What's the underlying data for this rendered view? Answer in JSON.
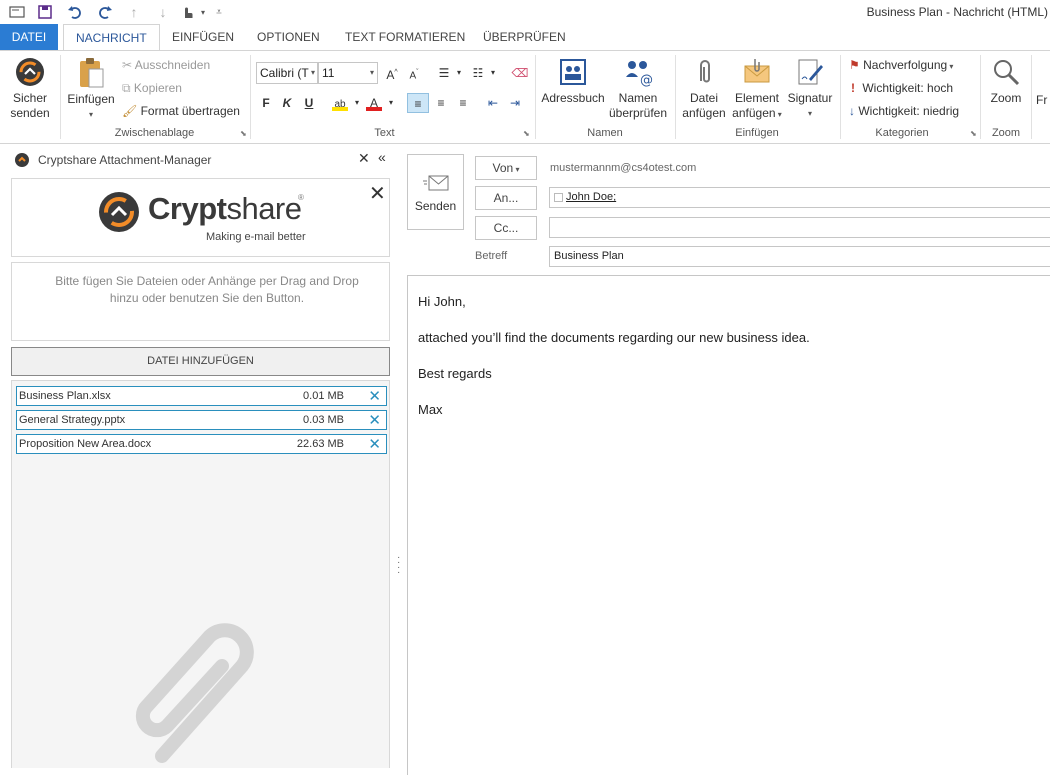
{
  "window": {
    "title": "Business Plan - Nachricht (HTML)"
  },
  "tabs": [
    "DATEI",
    "NACHRICHT",
    "EINFÜGEN",
    "OPTIONEN",
    "TEXT FORMATIEREN",
    "ÜBERPRÜFEN"
  ],
  "ribbon": {
    "secure_send": {
      "line1": "Sicher",
      "line2": "senden"
    },
    "clipboard": {
      "label": "Zwischenablage",
      "paste": "Einfügen",
      "cut": "Ausschneiden",
      "copy": "Kopieren",
      "format_painter": "Format übertragen"
    },
    "text": {
      "label": "Text",
      "font": "Calibri (T",
      "size": "11",
      "bold": "F",
      "italic": "K",
      "underline": "U"
    },
    "names": {
      "label": "Namen",
      "address_book": "Adressbuch",
      "check_names_1": "Namen",
      "check_names_2": "überprüfen"
    },
    "insert": {
      "label": "Einfügen",
      "attach_file_1": "Datei",
      "attach_file_2": "anfügen",
      "attach_item_1": "Element",
      "attach_item_2": "anfügen",
      "signature": "Signatur"
    },
    "tags": {
      "label": "Kategorien",
      "follow_up": "Nachverfolgung",
      "high_importance": "Wichtigkeit: hoch",
      "low_importance": "Wichtigkeit: niedrig"
    },
    "zoom": {
      "label": "Zoom",
      "button": "Zoom"
    },
    "cut_off_label": "Fr"
  },
  "sidepane": {
    "title": "Cryptshare Attachment-Manager",
    "logo_text_1": "Crypt",
    "logo_text_2": "share",
    "logo_tagline": "Making e-mail better",
    "drop_hint": "Bitte fügen Sie Dateien oder Anhänge per Drag and Drop hinzu oder benutzen Sie den Button.",
    "add_button": "DATEI HINZUFÜGEN",
    "files": [
      {
        "name": "Business Plan.xlsx",
        "size": "0.01 MB"
      },
      {
        "name": "General Strategy.pptx",
        "size": "0.03 MB"
      },
      {
        "name": "Proposition New Area.docx",
        "size": "22.63 MB"
      }
    ]
  },
  "compose": {
    "send": "Senden",
    "from_button": "Von",
    "from_value": "mustermannm@cs4otest.com",
    "to_button": "An...",
    "to_value": "John Doe;",
    "cc_button": "Cc...",
    "cc_value": "",
    "subject_label": "Betreff",
    "subject_value": "Business Plan",
    "body": [
      "Hi John,",
      "attached you’ll find the documents regarding our new business idea.",
      "Best regards",
      "Max"
    ]
  }
}
